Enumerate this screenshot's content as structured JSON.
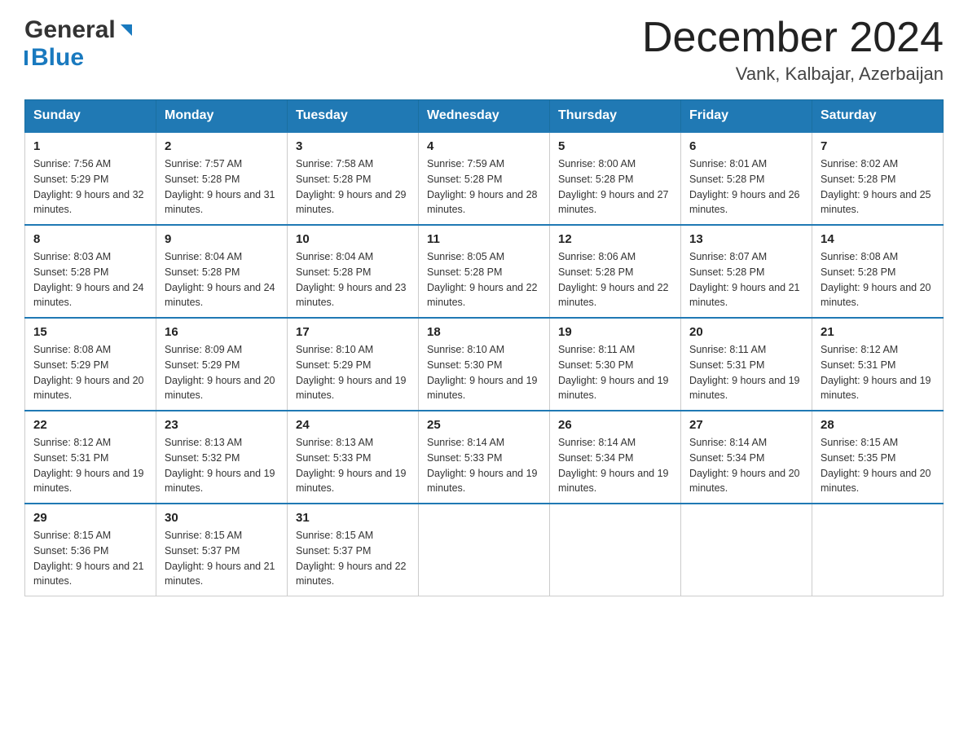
{
  "header": {
    "logo_general": "General",
    "logo_blue": "Blue",
    "month_title": "December 2024",
    "location": "Vank, Kalbajar, Azerbaijan"
  },
  "days_of_week": [
    "Sunday",
    "Monday",
    "Tuesday",
    "Wednesday",
    "Thursday",
    "Friday",
    "Saturday"
  ],
  "weeks": [
    [
      {
        "day": "1",
        "sunrise": "7:56 AM",
        "sunset": "5:29 PM",
        "daylight": "9 hours and 32 minutes."
      },
      {
        "day": "2",
        "sunrise": "7:57 AM",
        "sunset": "5:28 PM",
        "daylight": "9 hours and 31 minutes."
      },
      {
        "day": "3",
        "sunrise": "7:58 AM",
        "sunset": "5:28 PM",
        "daylight": "9 hours and 29 minutes."
      },
      {
        "day": "4",
        "sunrise": "7:59 AM",
        "sunset": "5:28 PM",
        "daylight": "9 hours and 28 minutes."
      },
      {
        "day": "5",
        "sunrise": "8:00 AM",
        "sunset": "5:28 PM",
        "daylight": "9 hours and 27 minutes."
      },
      {
        "day": "6",
        "sunrise": "8:01 AM",
        "sunset": "5:28 PM",
        "daylight": "9 hours and 26 minutes."
      },
      {
        "day": "7",
        "sunrise": "8:02 AM",
        "sunset": "5:28 PM",
        "daylight": "9 hours and 25 minutes."
      }
    ],
    [
      {
        "day": "8",
        "sunrise": "8:03 AM",
        "sunset": "5:28 PM",
        "daylight": "9 hours and 24 minutes."
      },
      {
        "day": "9",
        "sunrise": "8:04 AM",
        "sunset": "5:28 PM",
        "daylight": "9 hours and 24 minutes."
      },
      {
        "day": "10",
        "sunrise": "8:04 AM",
        "sunset": "5:28 PM",
        "daylight": "9 hours and 23 minutes."
      },
      {
        "day": "11",
        "sunrise": "8:05 AM",
        "sunset": "5:28 PM",
        "daylight": "9 hours and 22 minutes."
      },
      {
        "day": "12",
        "sunrise": "8:06 AM",
        "sunset": "5:28 PM",
        "daylight": "9 hours and 22 minutes."
      },
      {
        "day": "13",
        "sunrise": "8:07 AM",
        "sunset": "5:28 PM",
        "daylight": "9 hours and 21 minutes."
      },
      {
        "day": "14",
        "sunrise": "8:08 AM",
        "sunset": "5:28 PM",
        "daylight": "9 hours and 20 minutes."
      }
    ],
    [
      {
        "day": "15",
        "sunrise": "8:08 AM",
        "sunset": "5:29 PM",
        "daylight": "9 hours and 20 minutes."
      },
      {
        "day": "16",
        "sunrise": "8:09 AM",
        "sunset": "5:29 PM",
        "daylight": "9 hours and 20 minutes."
      },
      {
        "day": "17",
        "sunrise": "8:10 AM",
        "sunset": "5:29 PM",
        "daylight": "9 hours and 19 minutes."
      },
      {
        "day": "18",
        "sunrise": "8:10 AM",
        "sunset": "5:30 PM",
        "daylight": "9 hours and 19 minutes."
      },
      {
        "day": "19",
        "sunrise": "8:11 AM",
        "sunset": "5:30 PM",
        "daylight": "9 hours and 19 minutes."
      },
      {
        "day": "20",
        "sunrise": "8:11 AM",
        "sunset": "5:31 PM",
        "daylight": "9 hours and 19 minutes."
      },
      {
        "day": "21",
        "sunrise": "8:12 AM",
        "sunset": "5:31 PM",
        "daylight": "9 hours and 19 minutes."
      }
    ],
    [
      {
        "day": "22",
        "sunrise": "8:12 AM",
        "sunset": "5:31 PM",
        "daylight": "9 hours and 19 minutes."
      },
      {
        "day": "23",
        "sunrise": "8:13 AM",
        "sunset": "5:32 PM",
        "daylight": "9 hours and 19 minutes."
      },
      {
        "day": "24",
        "sunrise": "8:13 AM",
        "sunset": "5:33 PM",
        "daylight": "9 hours and 19 minutes."
      },
      {
        "day": "25",
        "sunrise": "8:14 AM",
        "sunset": "5:33 PM",
        "daylight": "9 hours and 19 minutes."
      },
      {
        "day": "26",
        "sunrise": "8:14 AM",
        "sunset": "5:34 PM",
        "daylight": "9 hours and 19 minutes."
      },
      {
        "day": "27",
        "sunrise": "8:14 AM",
        "sunset": "5:34 PM",
        "daylight": "9 hours and 20 minutes."
      },
      {
        "day": "28",
        "sunrise": "8:15 AM",
        "sunset": "5:35 PM",
        "daylight": "9 hours and 20 minutes."
      }
    ],
    [
      {
        "day": "29",
        "sunrise": "8:15 AM",
        "sunset": "5:36 PM",
        "daylight": "9 hours and 21 minutes."
      },
      {
        "day": "30",
        "sunrise": "8:15 AM",
        "sunset": "5:37 PM",
        "daylight": "9 hours and 21 minutes."
      },
      {
        "day": "31",
        "sunrise": "8:15 AM",
        "sunset": "5:37 PM",
        "daylight": "9 hours and 22 minutes."
      },
      null,
      null,
      null,
      null
    ]
  ]
}
